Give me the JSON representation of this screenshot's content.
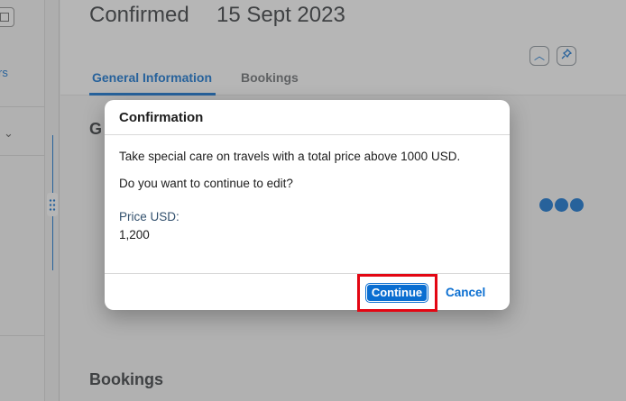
{
  "left_pane": {
    "link_fragment": "rs",
    "chevron": "⌄"
  },
  "header": {
    "status": "Confirmed",
    "date": "15 Sept 2023",
    "collapse_icon": "chevron-up-icon",
    "pin_icon": "pin-icon"
  },
  "tabs": [
    {
      "label": "General Information",
      "selected": true
    },
    {
      "label": "Bookings",
      "selected": false
    }
  ],
  "sections": {
    "general_fragment": "G",
    "bookings": "Bookings"
  },
  "dialog": {
    "title": "Confirmation",
    "message1": "Take special care on travels with a total price above 1000 USD.",
    "message2": "Do you want to continue to edit?",
    "field_label": "Price USD:",
    "field_value": "1,200",
    "continue_label": "Continue",
    "cancel_label": "Cancel"
  },
  "colors": {
    "accent": "#0a6ed1",
    "highlight": "#e30613"
  }
}
